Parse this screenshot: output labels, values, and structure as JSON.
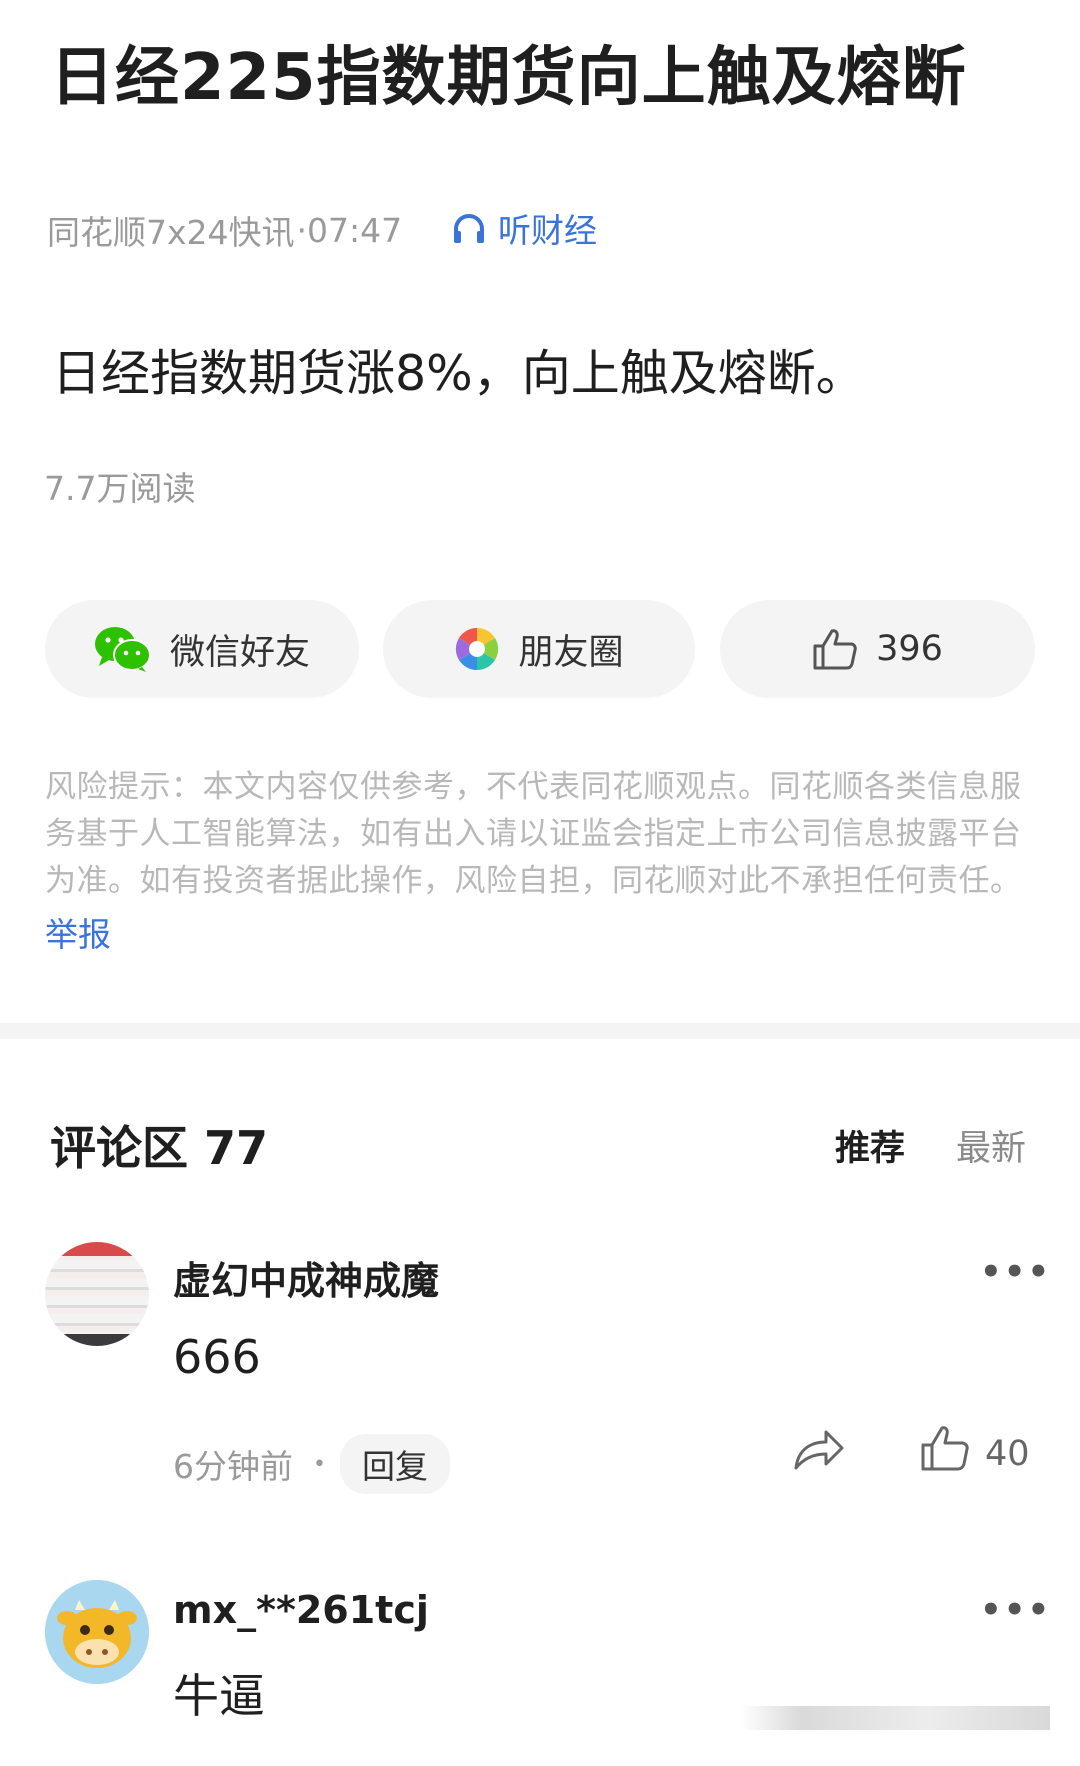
{
  "article": {
    "title": "日经225指数期货向上触及熔断",
    "source": "同花顺7x24快讯",
    "time": "·07:47",
    "listen_label": "听财经",
    "body": "日经指数期货涨8%，向上触及熔断。",
    "reads": "7.7万阅读"
  },
  "share": {
    "wechat_label": "微信好友",
    "moments_label": "朋友圈",
    "like_count": "396"
  },
  "risk": {
    "text": "风险提示：本文内容仅供参考，不代表同花顺观点。同花顺各类信息服务基于人工智能算法，如有出入请以证监会指定上市公司信息披露平台为准。如有投资者据此操作，风险自担，同花顺对此不承担任何责任。",
    "report_label": "举报"
  },
  "comments": {
    "header": "评论区 77",
    "sort_recommended": "推荐",
    "sort_latest": "最新",
    "items": [
      {
        "user": "虚幻中成神成魔",
        "text": "666",
        "time": "6分钟前",
        "reply_label": "回复",
        "likes": "40"
      },
      {
        "user": "mx_**261tcj",
        "text": "牛逼"
      }
    ]
  },
  "icons": {
    "more": "•••",
    "dot": "•"
  },
  "colors": {
    "accent": "#3a73d9",
    "wechat_green": "#2dc100"
  }
}
